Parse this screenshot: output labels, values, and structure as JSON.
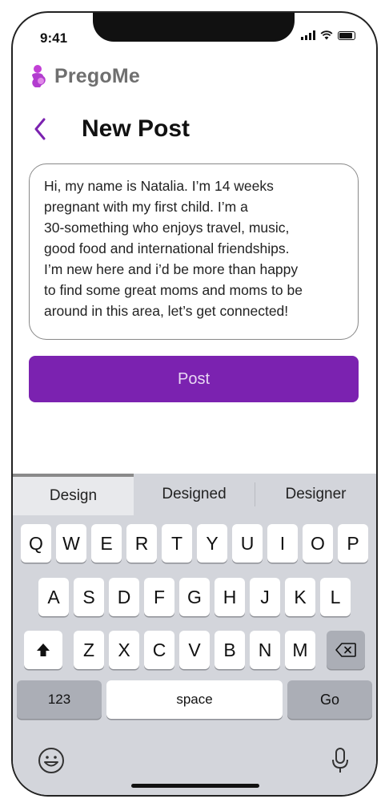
{
  "status": {
    "time": "9:41"
  },
  "brand": {
    "name": "PregoMe"
  },
  "header": {
    "title": "New Post"
  },
  "post": {
    "text": "Hi, my name is Natalia. I’m 14 weeks\npregnant with my first child. I’m a\n30-something who enjoys travel, music,\ngood food and international friendships.\nI’m new here and i’d be more than happy\nto find some great moms and moms to be\naround in this area, let’s get connected!",
    "button_label": "Post"
  },
  "keyboard": {
    "suggestions": [
      "Design",
      "Designed",
      "Designer"
    ],
    "row1": [
      "Q",
      "W",
      "E",
      "R",
      "T",
      "Y",
      "U",
      "I",
      "O",
      "P"
    ],
    "row2": [
      "A",
      "S",
      "D",
      "F",
      "G",
      "H",
      "J",
      "K",
      "L"
    ],
    "row3": [
      "Z",
      "X",
      "C",
      "V",
      "B",
      "N",
      "M"
    ],
    "numbers_label": "123",
    "space_label": "space",
    "go_label": "Go"
  },
  "colors": {
    "accent": "#7b22b0",
    "keyboard_bg": "#d3d5db"
  }
}
